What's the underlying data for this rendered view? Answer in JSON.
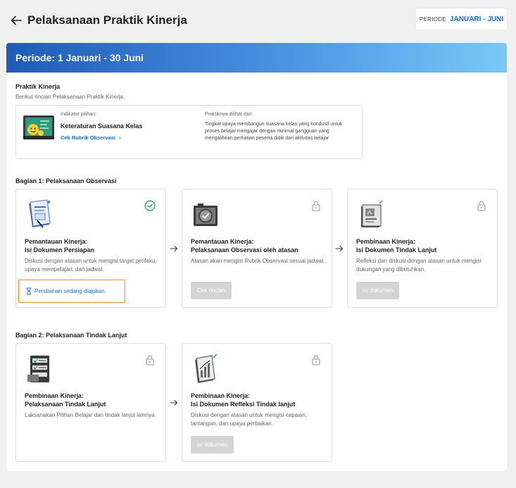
{
  "header": {
    "title": "Pelaksanaan Praktik Kinerja",
    "period_label": "PERIODE",
    "period_value": "JANUARI - JUNI"
  },
  "banner": {
    "title": "Periode: 1 Januari - 30 Juni"
  },
  "praktik": {
    "title": "Praktik Kinerja",
    "subtitle": "Berikut rincian Pelaksanaan Praktik Kinerja.",
    "indicator_label": "Indikator pilihan:",
    "indicator_value": "Keteraturan Suasana Kelas",
    "rubric_link": "Cek Rubrik Observasi",
    "seen_label": "Praktiknya dilihat dari:",
    "seen_value": "Tingkat upaya membangun suasana kelas yang kondusif untuk proses belajar mengajar dengan minimal gangguan yang mengalihkan perhatian peserta didik dari aktivitas belajar"
  },
  "section1": {
    "title": "Bagian 1: Pelaksanaan Observasi",
    "steps": [
      {
        "title_line1": "Pemantauan Kinerja:",
        "title_line2": "Isi Dokumen Persiapan",
        "desc": "Diskusi dengan atasan untuk mengisi target perilaku, upaya mempelajari, dan jadwal.",
        "pending_text": "Perubahan sedang diajukan.",
        "status": "completed"
      },
      {
        "title_line1": "Pemantauan Kinerja:",
        "title_line2": "Pelaksanaan Observasi oleh atasan",
        "desc": "Atasan akan mengisi Rubrik Observasi sesuai jadwal.",
        "button": "Cek rincian",
        "status": "locked"
      },
      {
        "title_line1": "Pembinaan Kinerja:",
        "title_line2": "Isi Dokumen Tindak Lanjut",
        "desc": "Refleksi dan diskusi dengan atasan untuk mengisi dukungan yang dibutuhkan.",
        "button": "Isi dokumen",
        "status": "locked"
      }
    ]
  },
  "section2": {
    "title": "Bagian 2: Pelaksanaan Tindak Lanjut",
    "steps": [
      {
        "title_line1": "Pembinaan Kinerja:",
        "title_line2": "Pelaksanaan Tindak Lanjut",
        "desc": "Laksanakan Pilihan Belajar dan tindak lanjut lainnya.",
        "status": "locked"
      },
      {
        "title_line1": "Pembinaan Kinerja:",
        "title_line2": "Isi Dokumen Refleksi Tindak lanjut",
        "desc": "Diskusi dengan atasan untuk mengisi capaian, tantangan, dan upaya perbaikan.",
        "button": "Isi dokumen",
        "status": "locked"
      }
    ]
  },
  "colors": {
    "accent": "#1b6ed6",
    "success": "#2e9e6e",
    "highlight_border": "#f28a1f",
    "banner_start": "#1f5bb5",
    "banner_end": "#7ac8f7"
  },
  "icons": {
    "back": "arrow-left-icon",
    "check": "check-circle-icon",
    "lock": "lock-icon",
    "hourglass": "hourglass-icon",
    "chevron": "chevron-right-icon",
    "step_arrow": "arrow-right-icon"
  }
}
